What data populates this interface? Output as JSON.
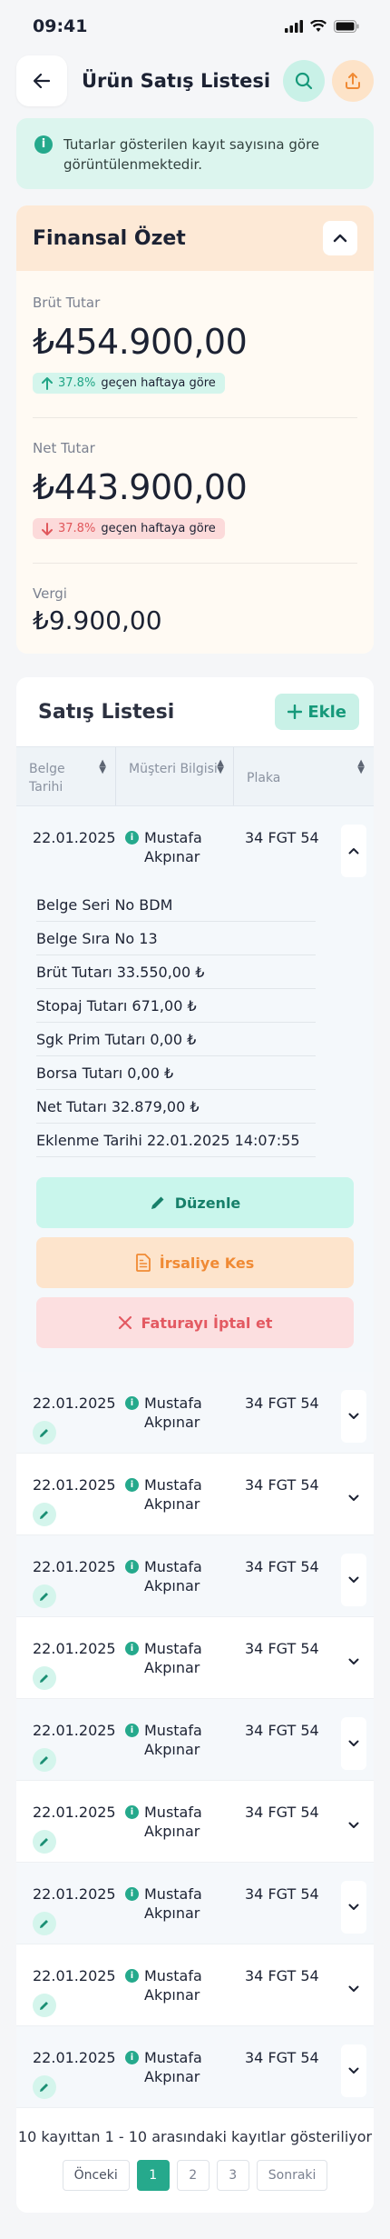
{
  "status": {
    "time": "09:41"
  },
  "header": {
    "title": "Ürün Satış Listesi"
  },
  "info": {
    "text": "Tutarlar gösterilen kayıt sayısına göre görüntülenmektedir."
  },
  "finance": {
    "title": "Finansal Özet",
    "gross_label": "Brüt Tutar",
    "gross_value": "₺454.900,00",
    "gross_pct": "37.8%",
    "gross_note": "geçen haftaya göre",
    "net_label": "Net Tutar",
    "net_value": "₺443.900,00",
    "net_pct": "37.8%",
    "net_note": "geçen haftaya göre",
    "tax_label": "Vergi",
    "tax_value": "₺9.900,00"
  },
  "sales": {
    "title": "Satış Listesi",
    "add_label": "Ekle",
    "col1": "Belge Tarihi",
    "col2": "Müşteri Bilgisi",
    "col3": "Plaka",
    "rows": [
      {
        "date": "22.01.2025",
        "customer": "Mustafa Akpınar",
        "plate": "34 FGT 54"
      },
      {
        "date": "22.01.2025",
        "customer": "Mustafa Akpınar",
        "plate": "34 FGT 54"
      },
      {
        "date": "22.01.2025",
        "customer": "Mustafa Akpınar",
        "plate": "34 FGT 54"
      },
      {
        "date": "22.01.2025",
        "customer": "Mustafa Akpınar",
        "plate": "34 FGT 54"
      },
      {
        "date": "22.01.2025",
        "customer": "Mustafa Akpınar",
        "plate": "34 FGT 54"
      },
      {
        "date": "22.01.2025",
        "customer": "Mustafa Akpınar",
        "plate": "34 FGT 54"
      },
      {
        "date": "22.01.2025",
        "customer": "Mustafa Akpınar",
        "plate": "34 FGT 54"
      },
      {
        "date": "22.01.2025",
        "customer": "Mustafa Akpınar",
        "plate": "34 FGT 54"
      },
      {
        "date": "22.01.2025",
        "customer": "Mustafa Akpınar",
        "plate": "34 FGT 54"
      },
      {
        "date": "22.01.2025",
        "customer": "Mustafa Akpınar",
        "plate": "34 FGT 54"
      }
    ],
    "details": [
      "Belge Seri No BDM",
      "Belge Sıra No 13",
      "Brüt Tutarı 33.550,00 ₺",
      "Stopaj Tutarı 671,00 ₺",
      "Sgk Prim Tutarı 0,00 ₺",
      "Borsa Tutarı 0,00 ₺",
      "Net Tutarı 32.879,00 ₺",
      "Eklenme Tarihi 22.01.2025 14:07:55"
    ],
    "edit_label": "Düzenle",
    "waybill_label": "İrsaliye Kes",
    "cancel_label": "Faturayı İptal et"
  },
  "footer": {
    "summary": "10 kayıttan 1 - 10 arasındaki kayıtlar gösteriliyor",
    "prev": "Önceki",
    "pages": [
      "1",
      "2",
      "3"
    ],
    "next": "Sonraki"
  },
  "colors": {
    "accent": "#26a98c",
    "warning": "#f08a34",
    "danger": "#e35a62"
  }
}
